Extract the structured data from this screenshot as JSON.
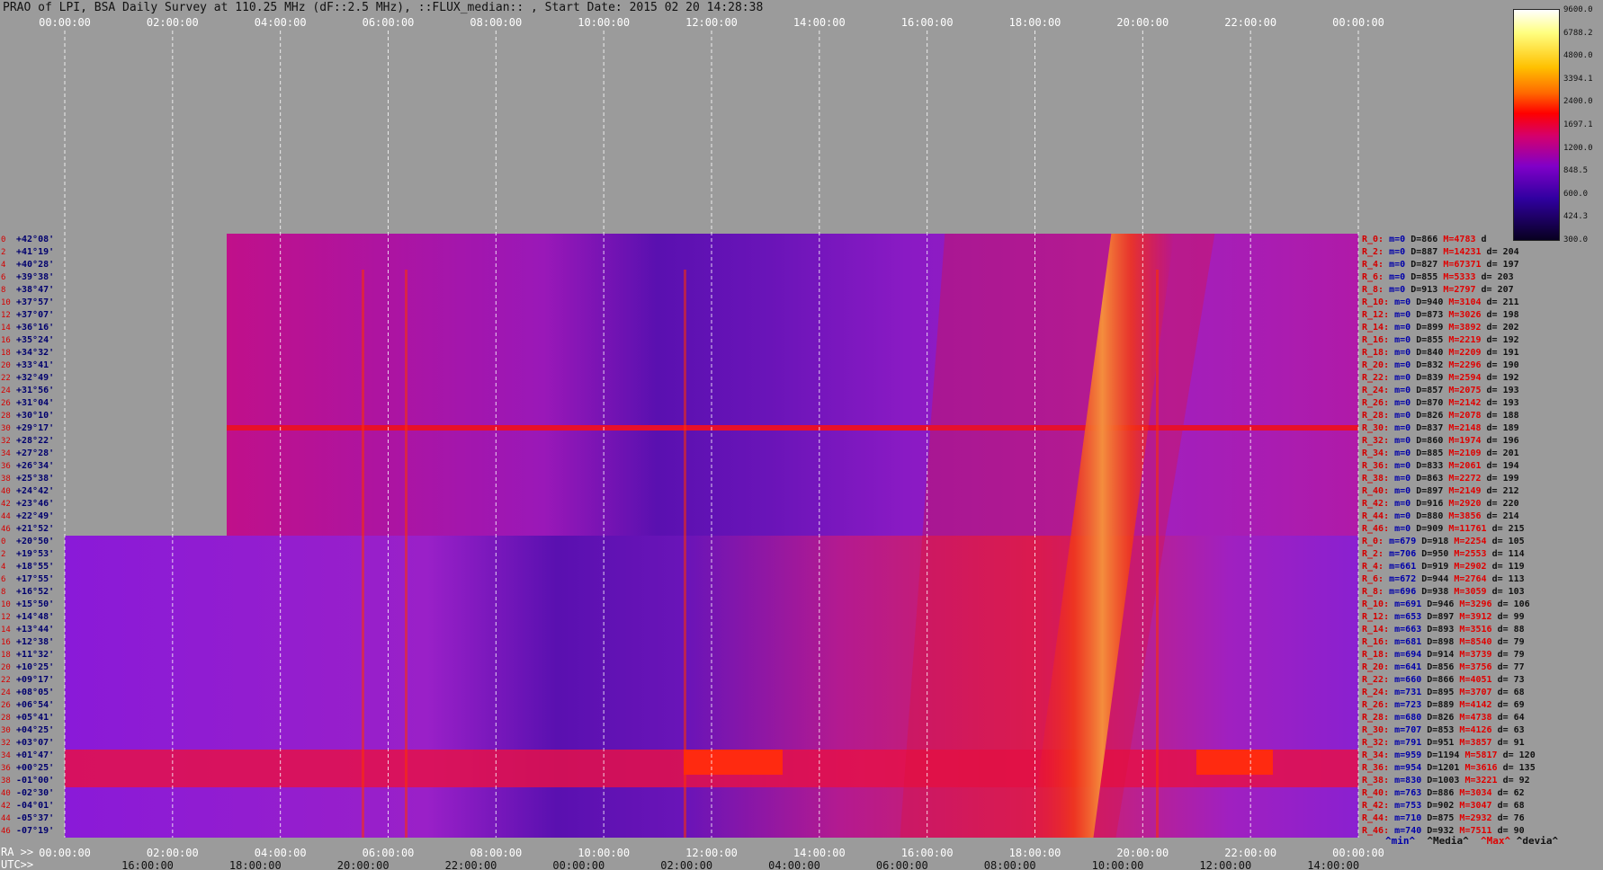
{
  "title": "PRAO of LPI, BSA Daily Survey at 110.25 MHz (dF::2.5 MHz), ::FLUX_median:: , Start Date: 2015 02 20 14:28:38",
  "top_ticks": [
    "00:00:00",
    "02:00:00",
    "04:00:00",
    "06:00:00",
    "08:00:00",
    "10:00:00",
    "12:00:00",
    "14:00:00",
    "16:00:00",
    "18:00:00",
    "20:00:00",
    "22:00:00",
    "00:00:00"
  ],
  "bottom_axis": {
    "ra_label": "RA >>",
    "utc_label": "UTC>>",
    "ra_ticks": [
      "00:00:00",
      "02:00:00",
      "04:00:00",
      "06:00:00",
      "08:00:00",
      "10:00:00",
      "12:00:00",
      "14:00:00",
      "16:00:00",
      "18:00:00",
      "20:00:00",
      "22:00:00",
      "00:00:00"
    ],
    "utc_ticks": [
      "16:00:00",
      "18:00:00",
      "20:00:00",
      "22:00:00",
      "00:00:00",
      "02:00:00",
      "04:00:00",
      "06:00:00",
      "08:00:00",
      "10:00:00",
      "12:00:00",
      "14:00:00"
    ]
  },
  "colorbar": {
    "ticks": [
      "9600.0",
      "6788.2",
      "4800.0",
      "3394.1",
      "2400.0",
      "1697.1",
      "1200.0",
      "848.5",
      "600.0",
      "424.3",
      "300.0"
    ]
  },
  "stats_legend": {
    "min": "^min^",
    "median": "^Media^",
    "max": "^Max^",
    "dev": "^devia^"
  },
  "rows": [
    {
      "idx": "0",
      "dec": "+42°08'",
      "r": "R_0:",
      "min": "m=0",
      "med": "D=866",
      "max": "M=4783",
      "dev": "d"
    },
    {
      "idx": "2",
      "dec": "+41°19'",
      "r": "R_2:",
      "min": "m=0",
      "med": "D=887",
      "max": "M=14231",
      "dev": "d= 204"
    },
    {
      "idx": "4",
      "dec": "+40°28'",
      "r": "R_4:",
      "min": "m=0",
      "med": "D=827",
      "max": "M=67371",
      "dev": "d= 197"
    },
    {
      "idx": "6",
      "dec": "+39°38'",
      "r": "R_6:",
      "min": "m=0",
      "med": "D=855",
      "max": "M=5333",
      "dev": "d= 203"
    },
    {
      "idx": "8",
      "dec": "+38°47'",
      "r": "R_8:",
      "min": "m=0",
      "med": "D=913",
      "max": "M=2797",
      "dev": "d= 207"
    },
    {
      "idx": "10",
      "dec": "+37°57'",
      "r": "R_10:",
      "min": "m=0",
      "med": "D=940",
      "max": "M=3104",
      "dev": "d= 211"
    },
    {
      "idx": "12",
      "dec": "+37°07'",
      "r": "R_12:",
      "min": "m=0",
      "med": "D=873",
      "max": "M=3026",
      "dev": "d= 198"
    },
    {
      "idx": "14",
      "dec": "+36°16'",
      "r": "R_14:",
      "min": "m=0",
      "med": "D=899",
      "max": "M=3892",
      "dev": "d= 202"
    },
    {
      "idx": "16",
      "dec": "+35°24'",
      "r": "R_16:",
      "min": "m=0",
      "med": "D=855",
      "max": "M=2219",
      "dev": "d= 192"
    },
    {
      "idx": "18",
      "dec": "+34°32'",
      "r": "R_18:",
      "min": "m=0",
      "med": "D=840",
      "max": "M=2209",
      "dev": "d= 191"
    },
    {
      "idx": "20",
      "dec": "+33°41'",
      "r": "R_20:",
      "min": "m=0",
      "med": "D=832",
      "max": "M=2296",
      "dev": "d= 190"
    },
    {
      "idx": "22",
      "dec": "+32°49'",
      "r": "R_22:",
      "min": "m=0",
      "med": "D=839",
      "max": "M=2594",
      "dev": "d= 192"
    },
    {
      "idx": "24",
      "dec": "+31°56'",
      "r": "R_24:",
      "min": "m=0",
      "med": "D=857",
      "max": "M=2075",
      "dev": "d= 193"
    },
    {
      "idx": "26",
      "dec": "+31°04'",
      "r": "R_26:",
      "min": "m=0",
      "med": "D=870",
      "max": "M=2142",
      "dev": "d= 193"
    },
    {
      "idx": "28",
      "dec": "+30°10'",
      "r": "R_28:",
      "min": "m=0",
      "med": "D=826",
      "max": "M=2078",
      "dev": "d= 188"
    },
    {
      "idx": "30",
      "dec": "+29°17'",
      "r": "R_30:",
      "min": "m=0",
      "med": "D=837",
      "max": "M=2148",
      "dev": "d= 189"
    },
    {
      "idx": "32",
      "dec": "+28°22'",
      "r": "R_32:",
      "min": "m=0",
      "med": "D=860",
      "max": "M=1974",
      "dev": "d= 196"
    },
    {
      "idx": "34",
      "dec": "+27°28'",
      "r": "R_34:",
      "min": "m=0",
      "med": "D=885",
      "max": "M=2109",
      "dev": "d= 201"
    },
    {
      "idx": "36",
      "dec": "+26°34'",
      "r": "R_36:",
      "min": "m=0",
      "med": "D=833",
      "max": "M=2061",
      "dev": "d= 194"
    },
    {
      "idx": "38",
      "dec": "+25°38'",
      "r": "R_38:",
      "min": "m=0",
      "med": "D=863",
      "max": "M=2272",
      "dev": "d= 199"
    },
    {
      "idx": "40",
      "dec": "+24°42'",
      "r": "R_40:",
      "min": "m=0",
      "med": "D=897",
      "max": "M=2149",
      "dev": "d= 212"
    },
    {
      "idx": "42",
      "dec": "+23°46'",
      "r": "R_42:",
      "min": "m=0",
      "med": "D=916",
      "max": "M=2920",
      "dev": "d= 220"
    },
    {
      "idx": "44",
      "dec": "+22°49'",
      "r": "R_44:",
      "min": "m=0",
      "med": "D=880",
      "max": "M=3856",
      "dev": "d= 214"
    },
    {
      "idx": "46",
      "dec": "+21°52'",
      "r": "R_46:",
      "min": "m=0",
      "med": "D=909",
      "max": "M=11761",
      "dev": "d= 215"
    },
    {
      "idx": "0",
      "dec": "+20°50'",
      "r": "R_0:",
      "min": "m=679",
      "med": "D=918",
      "max": "M=2254",
      "dev": "d= 105"
    },
    {
      "idx": "2",
      "dec": "+19°53'",
      "r": "R_2:",
      "min": "m=706",
      "med": "D=950",
      "max": "M=2553",
      "dev": "d= 114"
    },
    {
      "idx": "4",
      "dec": "+18°55'",
      "r": "R_4:",
      "min": "m=661",
      "med": "D=919",
      "max": "M=2902",
      "dev": "d= 119"
    },
    {
      "idx": "6",
      "dec": "+17°55'",
      "r": "R_6:",
      "min": "m=672",
      "med": "D=944",
      "max": "M=2764",
      "dev": "d= 113"
    },
    {
      "idx": "8",
      "dec": "+16°52'",
      "r": "R_8:",
      "min": "m=696",
      "med": "D=938",
      "max": "M=3059",
      "dev": "d= 103"
    },
    {
      "idx": "10",
      "dec": "+15°50'",
      "r": "R_10:",
      "min": "m=691",
      "med": "D=946",
      "max": "M=3296",
      "dev": "d= 106"
    },
    {
      "idx": "12",
      "dec": "+14°48'",
      "r": "R_12:",
      "min": "m=653",
      "med": "D=897",
      "max": "M=3912",
      "dev": "d= 99"
    },
    {
      "idx": "14",
      "dec": "+13°44'",
      "r": "R_14:",
      "min": "m=663",
      "med": "D=893",
      "max": "M=3516",
      "dev": "d= 88"
    },
    {
      "idx": "16",
      "dec": "+12°38'",
      "r": "R_16:",
      "min": "m=681",
      "med": "D=898",
      "max": "M=8540",
      "dev": "d= 79"
    },
    {
      "idx": "18",
      "dec": "+11°32'",
      "r": "R_18:",
      "min": "m=694",
      "med": "D=914",
      "max": "M=3739",
      "dev": "d= 79"
    },
    {
      "idx": "20",
      "dec": "+10°25'",
      "r": "R_20:",
      "min": "m=641",
      "med": "D=856",
      "max": "M=3756",
      "dev": "d= 77"
    },
    {
      "idx": "22",
      "dec": "+09°17'",
      "r": "R_22:",
      "min": "m=660",
      "med": "D=866",
      "max": "M=4051",
      "dev": "d= 73"
    },
    {
      "idx": "24",
      "dec": "+08°05'",
      "r": "R_24:",
      "min": "m=731",
      "med": "D=895",
      "max": "M=3707",
      "dev": "d= 68"
    },
    {
      "idx": "26",
      "dec": "+06°54'",
      "r": "R_26:",
      "min": "m=723",
      "med": "D=889",
      "max": "M=4142",
      "dev": "d= 69"
    },
    {
      "idx": "28",
      "dec": "+05°41'",
      "r": "R_28:",
      "min": "m=680",
      "med": "D=826",
      "max": "M=4738",
      "dev": "d= 64"
    },
    {
      "idx": "30",
      "dec": "+04°25'",
      "r": "R_30:",
      "min": "m=707",
      "med": "D=853",
      "max": "M=4126",
      "dev": "d= 63"
    },
    {
      "idx": "32",
      "dec": "+03°07'",
      "r": "R_32:",
      "min": "m=791",
      "med": "D=951",
      "max": "M=3857",
      "dev": "d= 91"
    },
    {
      "idx": "34",
      "dec": "+01°47'",
      "r": "R_34:",
      "min": "m=959",
      "med": "D=1194",
      "max": "M=5817",
      "dev": "d= 120"
    },
    {
      "idx": "36",
      "dec": "+00°25'",
      "r": "R_36:",
      "min": "m=954",
      "med": "D=1201",
      "max": "M=3616",
      "dev": "d= 135"
    },
    {
      "idx": "38",
      "dec": "-01°00'",
      "r": "R_38:",
      "min": "m=830",
      "med": "D=1003",
      "max": "M=3221",
      "dev": "d= 92"
    },
    {
      "idx": "40",
      "dec": "-02°30'",
      "r": "R_40:",
      "min": "m=763",
      "med": "D=886",
      "max": "M=3034",
      "dev": "d= 62"
    },
    {
      "idx": "42",
      "dec": "-04°01'",
      "r": "R_42:",
      "min": "m=753",
      "med": "D=902",
      "max": "M=3047",
      "dev": "d= 68"
    },
    {
      "idx": "44",
      "dec": "-05°37'",
      "r": "R_44:",
      "min": "m=710",
      "med": "D=875",
      "max": "M=2932",
      "dev": "d= 76"
    },
    {
      "idx": "46",
      "dec": "-07°19'",
      "r": "R_46:",
      "min": "m=740",
      "med": "D=932",
      "max": "M=7511",
      "dev": "d= 90"
    }
  ],
  "chart_data": {
    "type": "heatmap",
    "x_range_hours": [
      0,
      24
    ],
    "colorscale": [
      "#080020",
      "#3000a0",
      "#8000c8",
      "#d4006e",
      "#ff0000",
      "#ff6a00",
      "#ffc000",
      "#ffff80",
      "#ffffff"
    ],
    "color_range": [
      300.0,
      9600.0
    ],
    "grid": true,
    "features": {
      "bright_ridge_start_hours": 20.0,
      "bright_ridge_end_hours": 18.5
    }
  }
}
